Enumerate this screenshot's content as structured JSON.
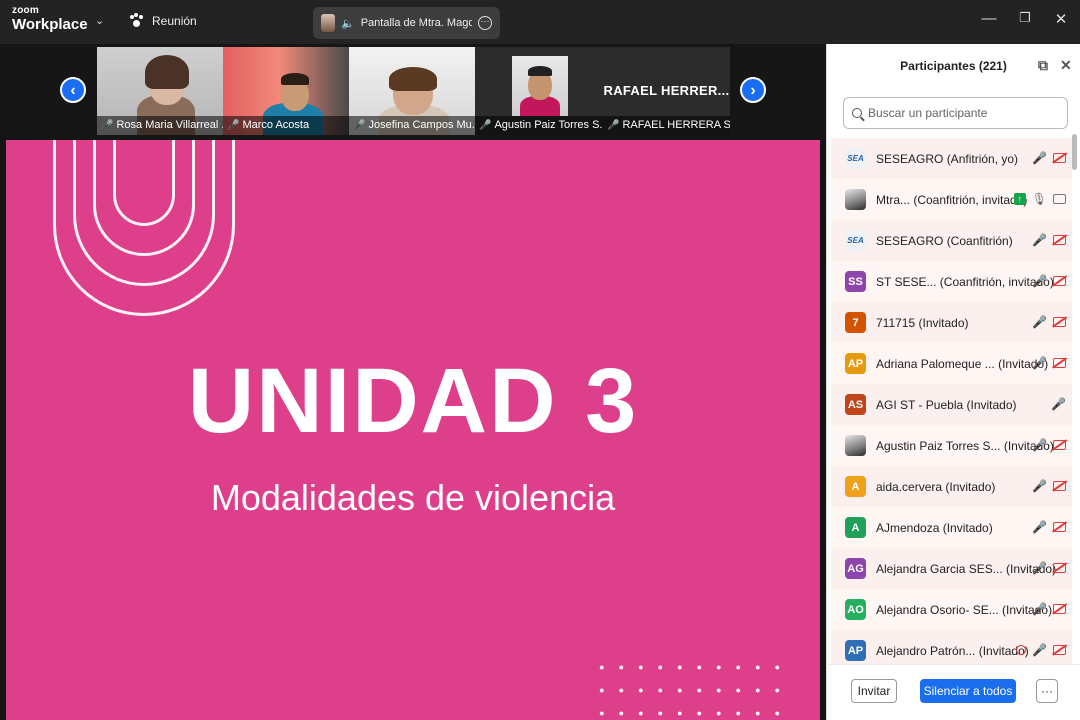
{
  "titlebar": {
    "brand_small": "zoom",
    "brand_large": "Workplace",
    "meeting_label": "Reunión",
    "share_pill_label": "Pantalla de Mtra. Magda Ro",
    "minimize": "—",
    "restore": "❐",
    "close": "✕"
  },
  "video_strip": {
    "prev": "‹",
    "next": "›",
    "tiles": [
      {
        "name": "Rosa Maria Villarreal ..."
      },
      {
        "name": "Marco Acosta"
      },
      {
        "name": "Josefina Campos Mu..."
      },
      {
        "name": "Agustin Paiz Torres S..."
      },
      {
        "name": "RAFAEL HERRERA SE...",
        "display_name": "RAFAEL HERRER..."
      }
    ]
  },
  "slide": {
    "title": "UNIDAD 3",
    "subtitle": "Modalidades de violencia",
    "background": "#de3f8a"
  },
  "participants": {
    "header": "Participantes (221)",
    "search_placeholder": "Buscar un participante",
    "rows": [
      {
        "avatar": "SEA",
        "avatar_type": "logo",
        "name": "SESEAGRO (Anfitrión, yo)",
        "mic": "muted",
        "cam": "off"
      },
      {
        "avatar": "",
        "avatar_type": "photo",
        "name": "Mtra... (Coanfitrión, invitado)",
        "mic": "on",
        "cam": "on",
        "sharing": true
      },
      {
        "avatar": "SEA",
        "avatar_type": "logo",
        "name": "SESEAGRO (Coanfitrión)",
        "mic": "muted",
        "cam": "off"
      },
      {
        "avatar": "SS",
        "color": "#8e44ad",
        "name": "ST SESE...   (Coanfitrión, invitado)",
        "mic": "muted",
        "cam": "off"
      },
      {
        "avatar": "7",
        "color": "#d35400",
        "name": "711715 (Invitado)",
        "mic": "muted",
        "cam": "off"
      },
      {
        "avatar": "AP",
        "color": "#e69a0e",
        "name": "Adriana Palomeque ...   (Invitado)",
        "mic": "muted",
        "cam": "off"
      },
      {
        "avatar": "AS",
        "color": "#c0461a",
        "name": "AGI ST - Puebla (Invitado)",
        "mic": "muted",
        "cam": "none"
      },
      {
        "avatar": "",
        "avatar_type": "photo",
        "name": "Agustin Paiz Torres S...   (Invitado)",
        "mic": "muted",
        "cam": "off"
      },
      {
        "avatar": "A",
        "color": "#f0a11c",
        "name": "aida.cervera (Invitado)",
        "mic": "muted",
        "cam": "off"
      },
      {
        "avatar": "A",
        "color": "#20a05a",
        "name": "AJmendoza (Invitado)",
        "mic": "muted",
        "cam": "off"
      },
      {
        "avatar": "AG",
        "color": "#8e44ad",
        "name": "Alejandra Garcia SES...   (Invitado)",
        "mic": "muted",
        "cam": "off"
      },
      {
        "avatar": "AO",
        "color": "#27ae60",
        "name": "Alejandra Osorio- SE...   (Invitado)",
        "mic": "muted",
        "cam": "off"
      },
      {
        "avatar": "AP",
        "color": "#2f6fb5",
        "name": "Alejandro Patrón...   (Invitado)",
        "mic": "muted",
        "cam": "off",
        "recording": true
      }
    ],
    "invite_label": "Invitar",
    "mute_all_label": "Silenciar a todos",
    "more_label": "···"
  }
}
